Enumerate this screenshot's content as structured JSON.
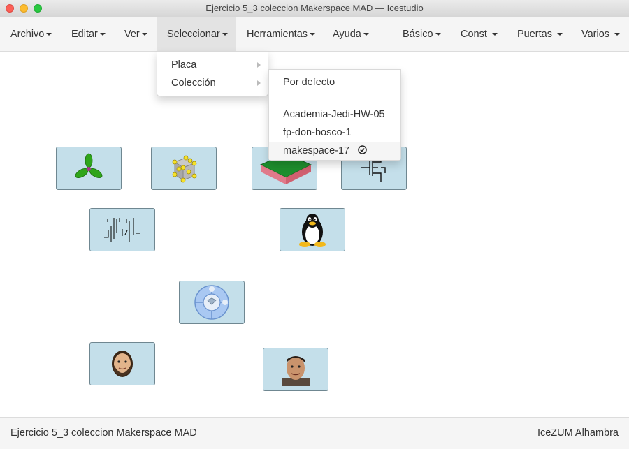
{
  "window": {
    "title": "Ejercicio 5_3 coleccion Makerspace MAD — Icestudio"
  },
  "menubar": {
    "left": [
      "Archivo",
      "Editar",
      "Ver",
      "Seleccionar",
      "Herramientas",
      "Ayuda"
    ],
    "right": [
      "Básico",
      "Const",
      "Puertas",
      "Varios"
    ]
  },
  "seleccionar_menu": {
    "items": [
      "Placa",
      "Colección"
    ]
  },
  "coleccion_submenu": {
    "default": "Por defecto",
    "collections": [
      "Academia-Jedi-HW-05",
      "fp-don-bosco-1",
      "makespace-17"
    ],
    "selected": "makespace-17"
  },
  "canvas": {
    "block_icons": [
      "clover-icon",
      "cube-atoms-icon",
      "board-icon",
      "transistor-icon",
      "signal-waveform-icon",
      "tux-penguin-icon",
      "puzzle-ring-icon",
      "avatar-bearded-man-icon",
      "avatar-man-icon"
    ]
  },
  "footer": {
    "project_name": "Ejercicio 5_3 coleccion Makerspace MAD",
    "board": "IceZUM Alhambra"
  },
  "colors": {
    "block_bg": "#c4dfea",
    "block_border": "#6f8791",
    "menubar_bg": "#f5f5f5",
    "active_menu_bg": "#e3e3e3"
  }
}
